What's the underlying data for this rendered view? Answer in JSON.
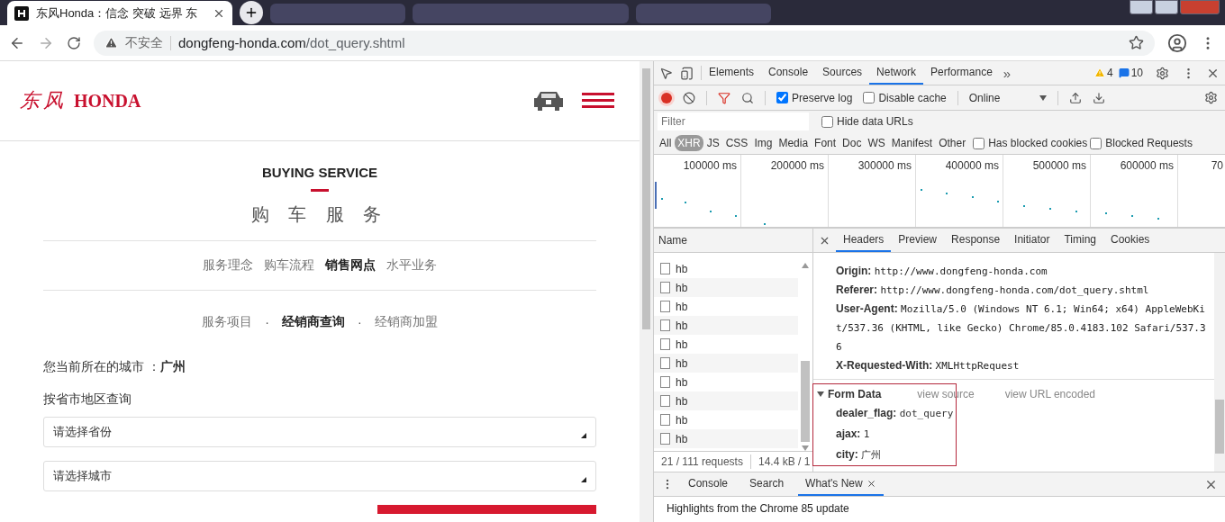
{
  "browser": {
    "tab_title": "东风Honda：信念 突破 远界 东",
    "security": "不安全",
    "url_host": "dongfeng-honda.com",
    "url_path": "/dot_query.shtml"
  },
  "site": {
    "logo_mark": "东风",
    "logo_word": "HONDA",
    "eyebrow": "BUYING SERVICE",
    "heading": "购 车 服 务",
    "tabs": [
      {
        "label": "服务理念",
        "selected": false
      },
      {
        "label": "购车流程",
        "selected": false
      },
      {
        "label": "销售网点",
        "selected": true
      },
      {
        "label": "水平业务",
        "selected": false
      }
    ],
    "subtabs": [
      {
        "label": "服务项目",
        "selected": false
      },
      {
        "label": "经销商查询",
        "selected": true
      },
      {
        "label": "经销商加盟",
        "selected": false
      }
    ],
    "subtab_separators": [
      "·",
      "·"
    ],
    "city_label": "您当前所在的城市 ：",
    "city": "广州",
    "region_label": "按省市地区查询",
    "selects": [
      {
        "value": "请选择省份"
      },
      {
        "value": "请选择城市"
      }
    ]
  },
  "devtools": {
    "panel_tabs": [
      {
        "label": "Elements",
        "selected": false
      },
      {
        "label": "Console",
        "selected": false
      },
      {
        "label": "Sources",
        "selected": false
      },
      {
        "label": "Network",
        "selected": true
      },
      {
        "label": "Performance",
        "selected": false
      }
    ],
    "more": "»",
    "warnings": "4",
    "messages": "10",
    "preserve_log": {
      "label": "Preserve log",
      "checked": true
    },
    "disable_cache": {
      "label": "Disable cache",
      "checked": false
    },
    "throttle": "Online",
    "filter": {
      "placeholder": "Filter"
    },
    "hide_data_urls": {
      "label": "Hide data URLs",
      "checked": false
    },
    "types": [
      {
        "label": "All",
        "selected": false
      },
      {
        "label": "XHR",
        "selected": true
      },
      {
        "label": "JS",
        "selected": false
      },
      {
        "label": "CSS",
        "selected": false
      },
      {
        "label": "Img",
        "selected": false
      },
      {
        "label": "Media",
        "selected": false
      },
      {
        "label": "Font",
        "selected": false
      },
      {
        "label": "Doc",
        "selected": false
      },
      {
        "label": "WS",
        "selected": false
      },
      {
        "label": "Manifest",
        "selected": false
      },
      {
        "label": "Other",
        "selected": false
      }
    ],
    "has_blocked_cookies": {
      "label": "Has blocked cookies",
      "checked": false
    },
    "blocked_requests": {
      "label": "Blocked Requests",
      "checked": false
    },
    "timeline_ticks": [
      "100000 ms",
      "200000 ms",
      "300000 ms",
      "400000 ms",
      "500000 ms",
      "600000 ms",
      "70"
    ],
    "name_column": "Name",
    "requests": [
      "hb",
      "hb",
      "hb",
      "hb",
      "hb",
      "hb",
      "hb",
      "hb",
      "hb",
      "hb"
    ],
    "summary": [
      "21 / 111 requests",
      "14.4 kB / 1"
    ],
    "detail_tabs": [
      {
        "label": "Headers",
        "selected": true
      },
      {
        "label": "Preview",
        "selected": false
      },
      {
        "label": "Response",
        "selected": false
      },
      {
        "label": "Initiator",
        "selected": false
      },
      {
        "label": "Timing",
        "selected": false
      },
      {
        "label": "Cookies",
        "selected": false
      }
    ],
    "headers": [
      {
        "name": "Origin:",
        "value": "http://www.dongfeng-honda.com"
      },
      {
        "name": "Referer:",
        "value": "http://www.dongfeng-honda.com/dot_query.shtml"
      },
      {
        "name": "User-Agent:",
        "value": "Mozilla/5.0 (Windows NT 6.1; Win64; x64) AppleWebKit/537.36 (KHTML, like Gecko) Chrome/85.0.4183.102 Safari/537.36"
      },
      {
        "name": "X-Requested-With:",
        "value": "XMLHttpRequest"
      }
    ],
    "form_data": {
      "title": "Form Data",
      "expanded": true,
      "highlighted": true,
      "view_source": "view source",
      "view_url_encoded": "view URL encoded",
      "fields": [
        {
          "name": "dealer_flag:",
          "value": "dot_query"
        },
        {
          "name": "ajax:",
          "value": "1"
        },
        {
          "name": "city:",
          "value": "广州"
        }
      ]
    },
    "drawer_tabs": [
      {
        "label": "Console",
        "selected": false,
        "closable": false
      },
      {
        "label": "Search",
        "selected": false,
        "closable": false
      },
      {
        "label": "What's New",
        "selected": true,
        "closable": true
      }
    ],
    "drawer_text": "Highlights from the Chrome 85 update"
  }
}
